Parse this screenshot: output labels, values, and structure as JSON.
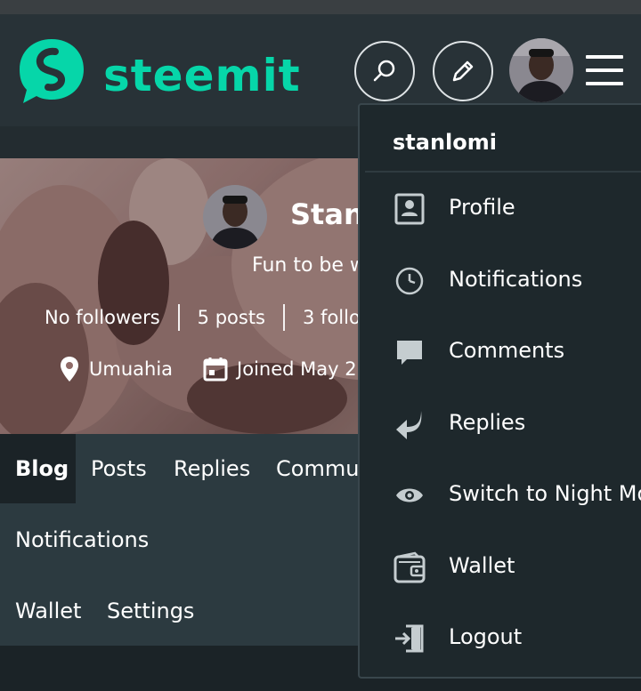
{
  "header": {
    "brand": "steemit",
    "logo_icon": "steemit-logo-icon",
    "search_icon": "search-icon",
    "edit_icon": "pencil-icon",
    "menu_icon": "hamburger-menu-icon",
    "brand_color": "#06d6a9"
  },
  "profile": {
    "name": "Stanl",
    "about": "Fun to be w",
    "followers": "No followers",
    "posts": "5 posts",
    "following": "3 follo",
    "location": "Umuahia",
    "joined": "Joined May 2"
  },
  "tabs": {
    "blog": "Blog",
    "posts": "Posts",
    "replies": "Replies",
    "communities": "Commu",
    "notifications": "Notifications",
    "wallet": "Wallet",
    "settings": "Settings"
  },
  "dropdown": {
    "username": "stanlomi",
    "items": [
      {
        "label": "Profile",
        "icon": "profile-card-icon"
      },
      {
        "label": "Notifications",
        "icon": "clock-icon"
      },
      {
        "label": "Comments",
        "icon": "comment-bubble-icon"
      },
      {
        "label": "Replies",
        "icon": "reply-arrow-icon"
      },
      {
        "label": "Switch to Night Mo",
        "icon": "eye-icon"
      },
      {
        "label": "Wallet",
        "icon": "wallet-icon"
      },
      {
        "label": "Logout",
        "icon": "logout-icon"
      }
    ]
  }
}
